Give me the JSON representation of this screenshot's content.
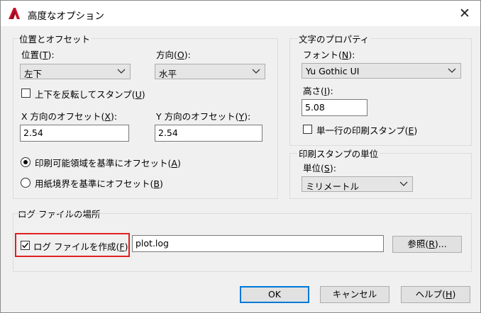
{
  "window": {
    "title": "高度なオプション"
  },
  "position_offset": {
    "group_label": "位置とオフセット",
    "position_label": "位置(",
    "position_key": "T",
    "position_tail": "):",
    "position_value": "左下",
    "orientation_label": "方向(",
    "orientation_key": "O",
    "orientation_tail": "):",
    "orientation_value": "水平",
    "flip_label": "上下を反転してスタンプ(",
    "flip_key": "U",
    "flip_tail": ")",
    "flip_checked": false,
    "x_offset_label": "X 方向のオフセット(",
    "x_offset_key": "X",
    "x_offset_tail": "):",
    "x_offset_value": "2.54",
    "y_offset_label": "Y 方向のオフセット(",
    "y_offset_key": "Y",
    "y_offset_tail": "):",
    "y_offset_value": "2.54",
    "radio_printable_label": "印刷可能領域を基準にオフセット(",
    "radio_printable_key": "A",
    "radio_printable_tail": ")",
    "radio_paper_label": "用紙境界を基準にオフセット(",
    "radio_paper_key": "B",
    "radio_paper_tail": ")",
    "selected_radio": "printable"
  },
  "text_properties": {
    "group_label": "文字のプロパティ",
    "font_label": "フォント(",
    "font_key": "N",
    "font_tail": "):",
    "font_value": "Yu Gothic UI",
    "height_label": "高さ(",
    "height_key": "I",
    "height_tail": "):",
    "height_value": "5.08",
    "single_line_label": "単一行の印刷スタンプ(",
    "single_line_key": "E",
    "single_line_tail": ")",
    "single_line_checked": false
  },
  "stamp_units": {
    "group_label": "印刷スタンプの単位",
    "units_label": "単位(",
    "units_key": "S",
    "units_tail": "):",
    "units_value": "ミリメートル"
  },
  "log_file": {
    "group_label": "ログ ファイルの場所",
    "create_label": "ログ ファイルを作成(",
    "create_key": "F",
    "create_tail": ")",
    "create_checked": true,
    "path_value": "plot.log",
    "browse_label": "参照(",
    "browse_key": "R",
    "browse_tail": ")..."
  },
  "buttons": {
    "ok": "OK",
    "cancel": "キャンセル",
    "help_label": "ヘルプ(",
    "help_key": "H",
    "help_tail": ")"
  },
  "colors": {
    "accent": "#0078d7",
    "highlight": "#e02020",
    "app_icon": "#c8102e"
  }
}
